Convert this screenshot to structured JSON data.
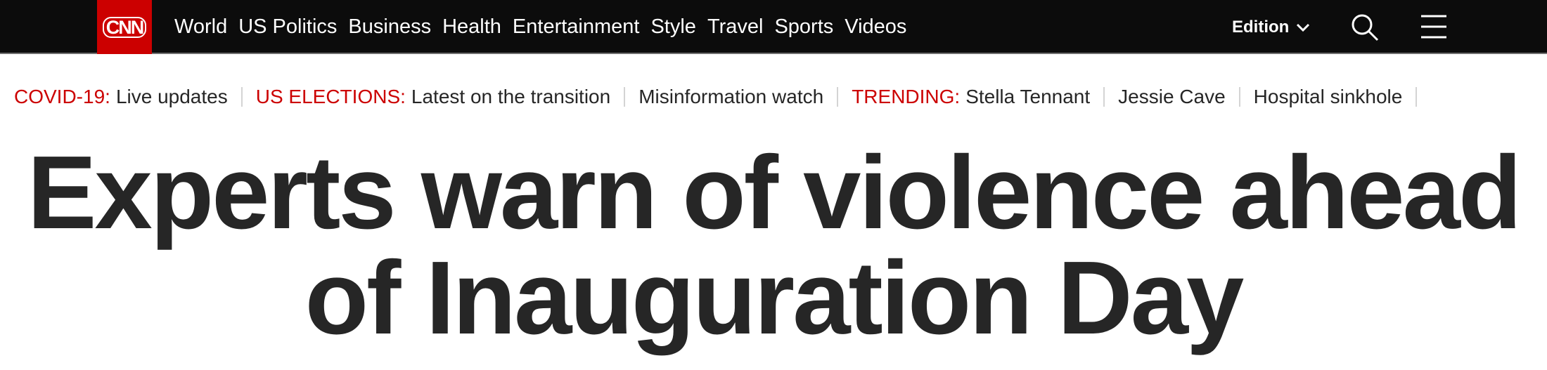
{
  "header": {
    "logo_text": "CNN",
    "nav": [
      "World",
      "US Politics",
      "Business",
      "Health",
      "Entertainment",
      "Style",
      "Travel",
      "Sports",
      "Videos"
    ],
    "edition_label": "Edition",
    "icons": {
      "edition": "chevron-down-icon",
      "search": "search-icon",
      "menu": "menu-icon"
    }
  },
  "trending_bar": {
    "covid": {
      "label": "COVID-19:",
      "link": "Live updates"
    },
    "elections": {
      "label": "US ELECTIONS:",
      "link": "Latest on the transition"
    },
    "misinfo": "Misinformation watch",
    "trending": {
      "label": "TRENDING:",
      "links": [
        "Stella Tennant",
        "Jessie Cave",
        "Hospital sinkhole"
      ]
    }
  },
  "article": {
    "headline": "Experts warn of violence ahead of Inauguration Day"
  },
  "colors": {
    "brand_red": "#cc0000",
    "nav_bg": "#0c0c0c",
    "text": "#262626"
  }
}
